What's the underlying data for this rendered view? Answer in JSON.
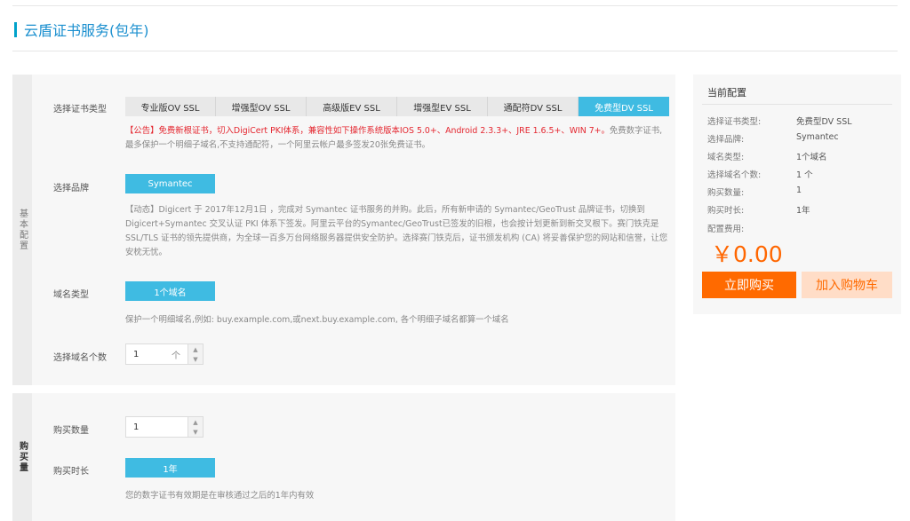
{
  "page": {
    "title": "云盾证书服务(包年)"
  },
  "panel1": {
    "tab_label": "基本配置",
    "cert_type_label": "选择证书类型",
    "cert_types": [
      "专业版OV SSL",
      "增强型OV SSL",
      "高级版EV SSL",
      "增强型EV SSL",
      "通配符DV SSL",
      "免费型DV SSL"
    ],
    "notice_red": "【公告】免费新根证书，切入DigiCert PKI体系，兼容性如下操作系统版本IOS 5.0+、Android 2.3.3+、JRE 1.6.5+、WIN 7+。",
    "notice_gray": "免费数字证书,最多保护一个明细子域名,不支持通配符，一个阿里云帐户最多签发20张免费证书。",
    "brand_label": "选择品牌",
    "brand_value": "Symantec",
    "dynamic_text": "【动态】Digicert 于 2017年12月1日 ，完成对 Symantec 证书服务的并购。此后，所有新申请的 Symantec/GeoTrust 品牌证书，切换到 Digicert+Symantec 交叉认证 PKI 体系下签发。阿里云平台的Symantec/GeoTrust已签发的旧根，也会按计划更新到新交叉根下。赛门铁克是 SSL/TLS 证书的领先提供商，为全球一百多万台网络服务器提供安全防护。选择赛门铁克后，证书颁发机构 (CA) 将妥善保护您的网站和信誉，让您安枕无忧。",
    "domain_type_label": "域名类型",
    "domain_type_value": "1个域名",
    "domain_hint": "保护一个明细域名,例如: buy.example.com,或next.buy.example.com, 各个明细子域名都算一个域名",
    "domain_count_label": "选择域名个数",
    "domain_count_value": "1",
    "domain_count_unit": "个"
  },
  "panel2": {
    "tab_label": "购买量",
    "qty_label": "购买数量",
    "qty_value": "1",
    "duration_label": "购买时长",
    "duration_value": "1年",
    "validity_hint": "您的数字证书有效期是在审核通过之后的1年内有效"
  },
  "summary": {
    "heading": "当前配置",
    "rows": [
      {
        "label": "选择证书类型:",
        "value": "免费型DV SSL"
      },
      {
        "label": "选择品牌:",
        "value": "Symantec"
      },
      {
        "label": "域名类型:",
        "value": "1个域名"
      },
      {
        "label": "选择域名个数:",
        "value": "1 个"
      },
      {
        "label": "购买数量:",
        "value": "1"
      },
      {
        "label": "购买时长:",
        "value": "1年"
      }
    ],
    "fee_label": "配置费用:",
    "price": "￥0.00",
    "buy_label": "立即购买",
    "cart_label": "加入购物车"
  },
  "colors": {
    "accent": "#3fbbe2",
    "orange": "#ff6a00",
    "notice_red": "#e4262f"
  },
  "icons": {
    "step_up": "caret-up-icon",
    "step_down": "caret-down-icon"
  }
}
